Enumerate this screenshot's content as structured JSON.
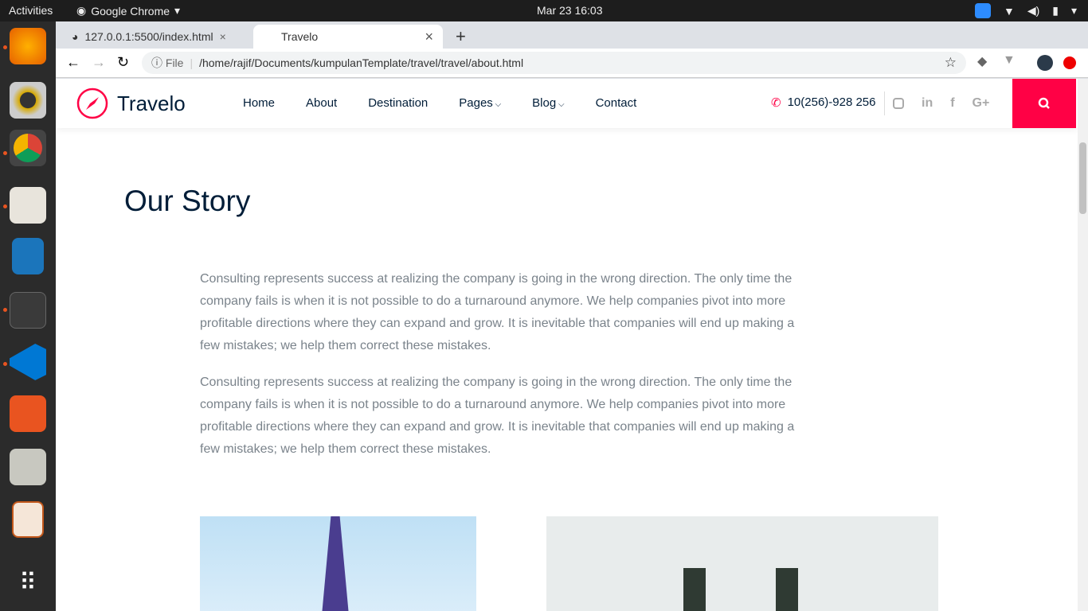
{
  "os": {
    "activities": "Activities",
    "app": "Google Chrome",
    "clock": "Mar 23  16:03"
  },
  "browser": {
    "tabs": [
      {
        "label": "127.0.0.1:5500/index.html"
      },
      {
        "label": "Travelo"
      }
    ],
    "omnibox_prefix": "File",
    "url": "/home/rajif/Documents/kumpulanTemplate/travel/travel/about.html"
  },
  "site": {
    "logo": "Travelo",
    "nav": [
      "Home",
      "About",
      "Destination",
      "Pages",
      "Blog",
      "Contact"
    ],
    "phone": "10(256)-928 256",
    "social": [
      "instagram",
      "in",
      "f",
      "G+"
    ]
  },
  "main": {
    "title": "Our Story",
    "paragraphs": [
      "Consulting represents success at realizing the company is going in the wrong direction. The only time the company fails is when it is not possible to do a turnaround anymore. We help companies pivot into more profitable directions where they can expand and grow. It is inevitable that companies will end up making a few mistakes; we help them correct these mistakes.",
      "Consulting represents success at realizing the company is going in the wrong direction. The only time the company fails is when it is not possible to do a turnaround anymore. We help companies pivot into more profitable directions where they can expand and grow. It is inevitable that companies will end up making a few mistakes; we help them correct these mistakes."
    ]
  },
  "colors": {
    "accent": "#ff0145",
    "heading": "#001d38"
  }
}
